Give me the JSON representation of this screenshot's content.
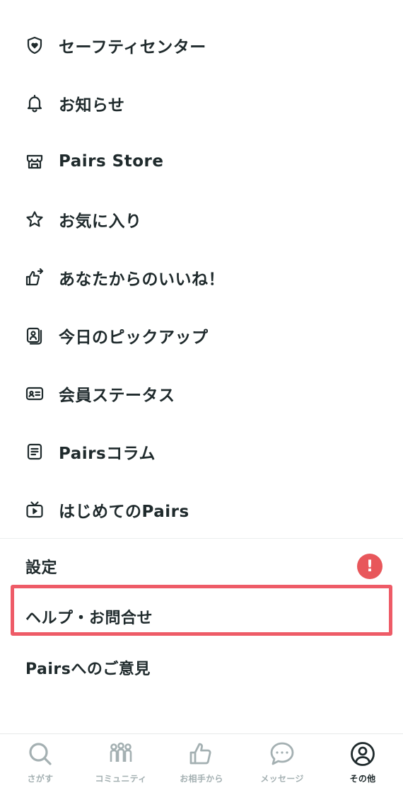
{
  "menu": {
    "items": [
      {
        "label": "セーフティセンター",
        "icon": "shield-heart-icon"
      },
      {
        "label": "お知らせ",
        "icon": "bell-icon"
      },
      {
        "label": "Pairs Store",
        "icon": "store-icon"
      },
      {
        "label": "お気に入り",
        "icon": "star-icon"
      },
      {
        "label": "あなたからのいいね！",
        "icon": "thumbs-up-send-icon"
      },
      {
        "label": "今日のピックアップ",
        "icon": "pickup-card-icon"
      },
      {
        "label": "会員ステータス",
        "icon": "member-card-icon"
      },
      {
        "label": "Pairsコラム",
        "icon": "article-icon"
      },
      {
        "label": "はじめてのPairs",
        "icon": "tv-play-icon"
      }
    ]
  },
  "settings": {
    "rows": [
      {
        "label": "設定",
        "alert": "!"
      },
      {
        "label": "ヘルプ・お問合せ"
      },
      {
        "label": "Pairsへのご意見"
      }
    ]
  },
  "highlight_color": "#ee5b67",
  "alert_color": "#e8575b",
  "tabbar": {
    "tabs": [
      {
        "label": "さがす",
        "icon": "search-icon",
        "active": false
      },
      {
        "label": "コミュニティ",
        "icon": "community-icon",
        "active": false
      },
      {
        "label": "お相手から",
        "icon": "thumbs-up-icon",
        "active": false
      },
      {
        "label": "メッセージ",
        "icon": "message-icon",
        "active": false
      },
      {
        "label": "その他",
        "icon": "profile-icon",
        "active": true
      }
    ]
  }
}
